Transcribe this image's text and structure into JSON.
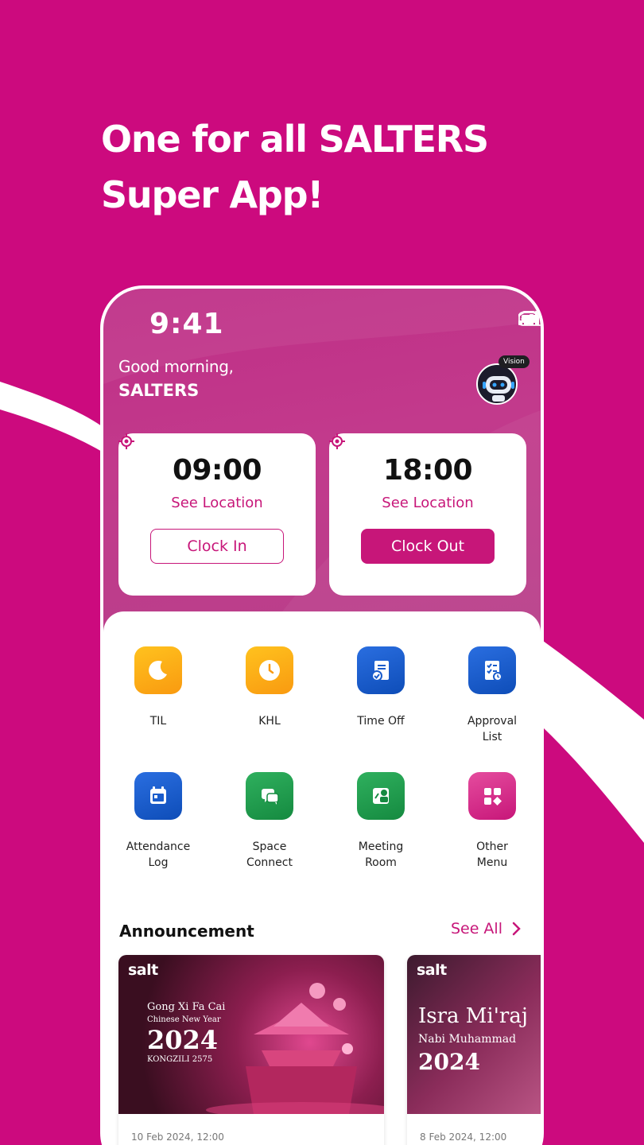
{
  "colors": {
    "brand": "#CC0A7E",
    "accent": "#C71679"
  },
  "headline": {
    "line1": "One for all SALTERS",
    "line2": "Super App!"
  },
  "status_bar": {
    "time": "9:41",
    "icons": [
      "signal-icon",
      "wifi-icon",
      "battery-icon"
    ]
  },
  "greeting": {
    "text": "Good morning,",
    "name": "SALTERS"
  },
  "assistant": {
    "badge": "Vision"
  },
  "clock_in": {
    "time": "09:00",
    "location_label": "See Location",
    "button_label": "Clock In"
  },
  "clock_out": {
    "time": "18:00",
    "location_label": "See Location",
    "button_label": "Clock Out"
  },
  "menu": {
    "items": [
      {
        "label": "TIL",
        "icon": "moon-icon",
        "color": "orange"
      },
      {
        "label": "KHL",
        "icon": "clock-icon",
        "color": "orange"
      },
      {
        "label": "Time Off",
        "icon": "document-check-icon",
        "color": "blue"
      },
      {
        "label": "Approval List",
        "icon": "checklist-icon",
        "color": "blue"
      },
      {
        "label": "Attendance Log",
        "icon": "calendar-icon",
        "color": "blue"
      },
      {
        "label": "Space Connect",
        "icon": "chat-icon",
        "color": "green"
      },
      {
        "label": "Meeting Room",
        "icon": "meeting-room-icon",
        "color": "green"
      },
      {
        "label": "Other Menu",
        "icon": "grid-icon",
        "color": "pink"
      }
    ]
  },
  "announcements": {
    "title": "Announcement",
    "see_all": "See All",
    "cards": [
      {
        "brand": "salt",
        "lines": [
          "Gong Xi Fa Cai",
          "Chinese New Year",
          "2024",
          "KONGZILI 2575"
        ],
        "date": "10 Feb 2024, 12:00"
      },
      {
        "brand": "salt",
        "lines": [
          "Isra Mi'raj",
          "Nabi Muhammad",
          "2024"
        ],
        "date": "8 Feb 2024, 12:00"
      }
    ]
  }
}
